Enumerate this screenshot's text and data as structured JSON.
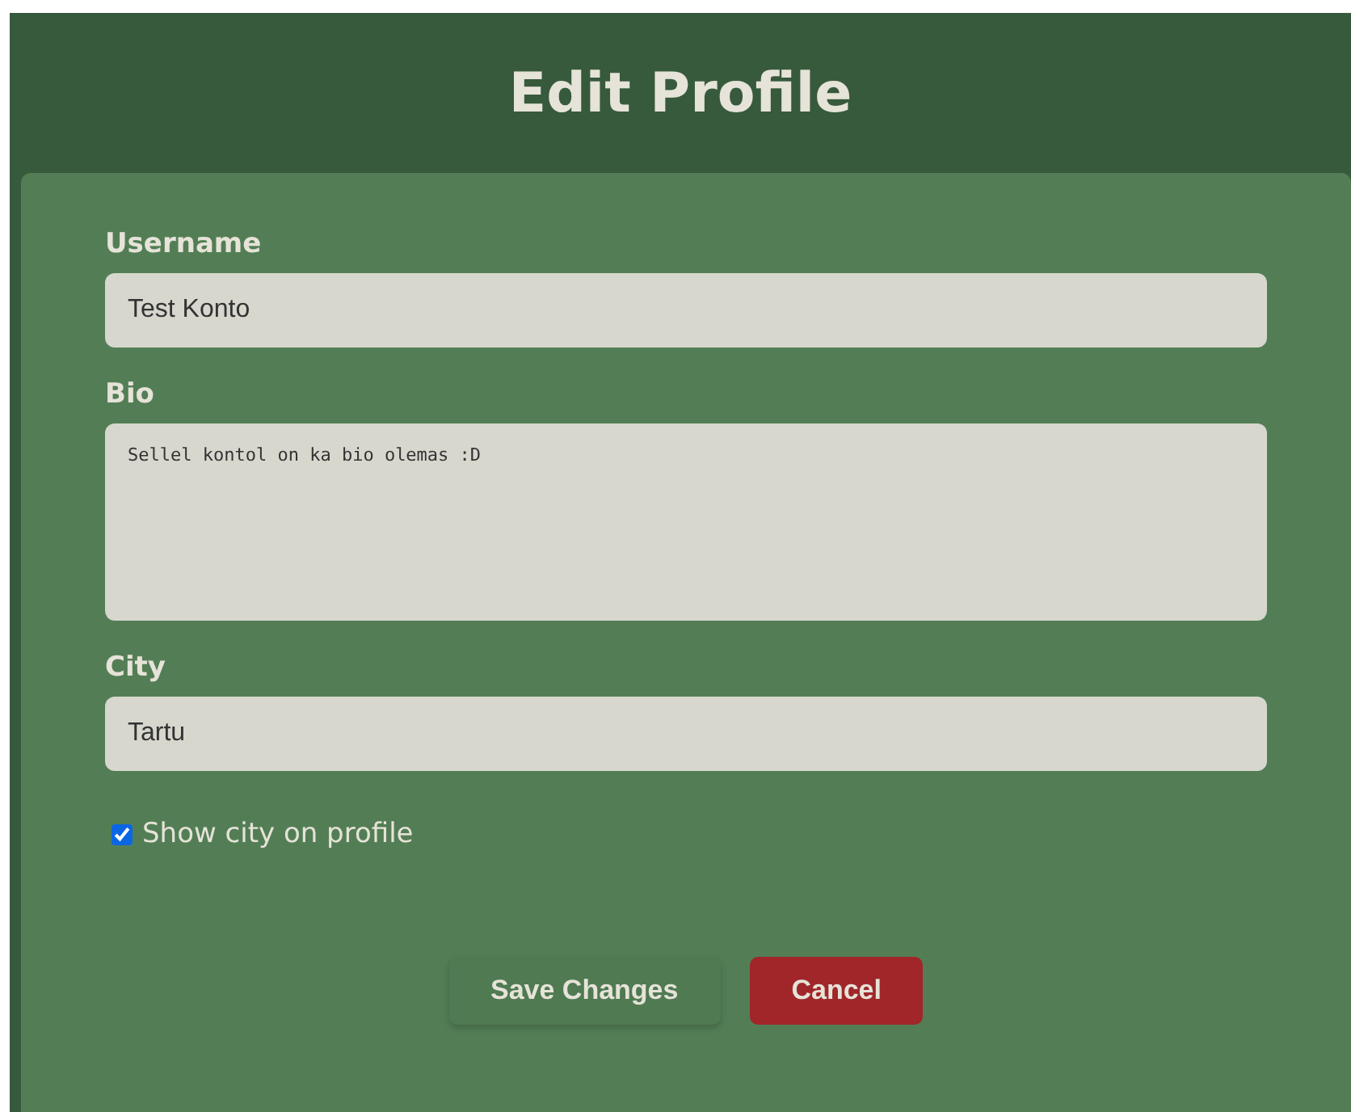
{
  "title": "Edit Profile",
  "fields": [
    {
      "kind": "input",
      "label": "Username",
      "value": "Test Konto"
    },
    {
      "kind": "textarea",
      "label": "Bio",
      "value": "Sellel kontol on ka bio olemas :D"
    },
    {
      "kind": "input",
      "label": "City",
      "value": "Tartu"
    }
  ],
  "checkbox": {
    "label": "Show city on profile",
    "checked": true
  },
  "buttons": [
    {
      "kind": "primary",
      "label": "Save Changes"
    },
    {
      "kind": "danger",
      "label": "Cancel"
    }
  ]
}
